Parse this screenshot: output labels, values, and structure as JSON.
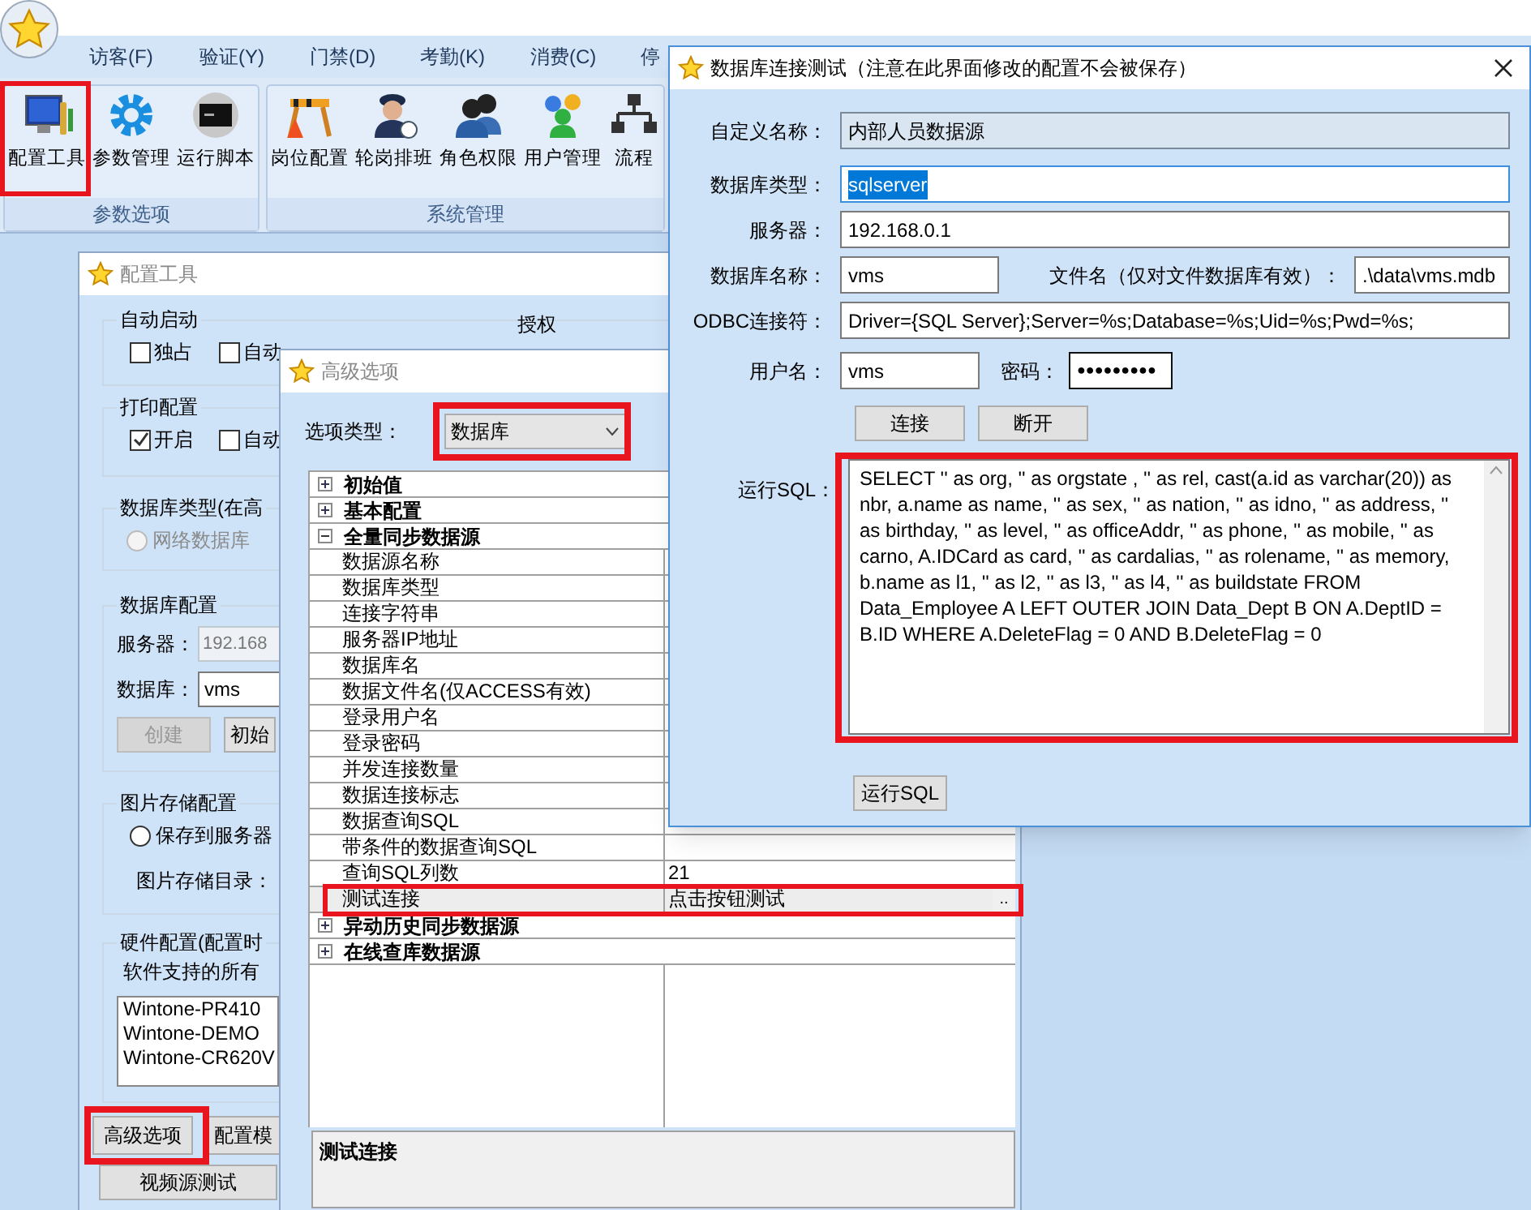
{
  "app": {
    "menu": [
      "访客(F)",
      "验证(Y)",
      "门禁(D)",
      "考勤(K)",
      "消费(C)",
      "停"
    ],
    "ribbon_groups": [
      {
        "label": "参数选项",
        "buttons": [
          {
            "label": "配置工具",
            "kind": "monitor"
          },
          {
            "label": "参数管理",
            "kind": "gear"
          },
          {
            "label": "运行脚本",
            "kind": "terminal"
          }
        ]
      },
      {
        "label": "系统管理",
        "buttons": [
          {
            "label": "岗位配置",
            "kind": "barrier"
          },
          {
            "label": "轮岗排班",
            "kind": "guard"
          },
          {
            "label": "角色权限",
            "kind": "pair"
          },
          {
            "label": "用户管理",
            "kind": "users"
          },
          {
            "label": "流程",
            "kind": "flow"
          }
        ]
      }
    ]
  },
  "config_tool": {
    "title": "配置工具",
    "auth_label": "授权",
    "auto_start": {
      "legend": "自动启动",
      "options": [
        {
          "label": "独占",
          "checked": false
        },
        {
          "label": "自动",
          "checked": false
        }
      ]
    },
    "print": {
      "legend": "打印配置",
      "options": [
        {
          "label": "开启",
          "checked": true
        },
        {
          "label": "自动",
          "checked": false
        }
      ]
    },
    "db_type": {
      "legend": "数据库类型(在高",
      "option": {
        "label": "网络数据库",
        "selected": false,
        "disabled": true
      }
    },
    "db_config": {
      "legend": "数据库配置",
      "server_label": "服务器：",
      "server_value": "192.168",
      "server_disabled": true,
      "database_label": "数据库：",
      "database_value": "vms",
      "buttons": [
        {
          "label": "创建",
          "disabled": true
        },
        {
          "label": "初始",
          "disabled": false
        }
      ]
    },
    "image_storage": {
      "legend": "图片存储配置",
      "option": {
        "label": "保存到服务器",
        "selected": false,
        "disabled": false
      },
      "dir_label": "图片存储目录："
    },
    "hardware": {
      "legend": "硬件配置(配置时",
      "caption": "软件支持的所有",
      "devices": [
        "Wintone-PR410",
        "Wintone-DEMO",
        "Wintone-CR620V"
      ]
    },
    "buttons": [
      "高级选项",
      "配置模"
    ],
    "video_button": "视频源测试"
  },
  "advanced_options": {
    "title": "高级选项",
    "option_type_label": "选项类型：",
    "option_type_value": "数据库",
    "grid": [
      {
        "label": "初始值",
        "expanded": false
      },
      {
        "label": "基本配置",
        "expanded": false
      },
      {
        "label": "全量同步数据源",
        "expanded": true,
        "children": [
          {
            "name": "数据源名称",
            "selected": false
          },
          {
            "name": "数据库类型",
            "selected": false
          },
          {
            "name": "连接字符串",
            "selected": false
          },
          {
            "name": "服务器IP地址",
            "selected": false
          },
          {
            "name": "数据库名",
            "selected": false
          },
          {
            "name": "数据文件名(仅ACCESS有效)",
            "selected": false
          },
          {
            "name": "登录用户名",
            "selected": false
          },
          {
            "name": "登录密码",
            "selected": false
          },
          {
            "name": "并发连接数量",
            "selected": false
          },
          {
            "name": "数据连接标志",
            "selected": false
          },
          {
            "name": "数据查询SQL",
            "selected": false
          },
          {
            "name": "带条件的数据查询SQL",
            "selected": false
          },
          {
            "name": "查询SQL列数",
            "value": "21",
            "selected": false
          },
          {
            "name": "测试连接",
            "value": "点击按钮测试",
            "button": "..",
            "selected": true
          }
        ]
      },
      {
        "label": "异动历史同步数据源",
        "expanded": false
      },
      {
        "label": "在线查库数据源",
        "expanded": false
      }
    ],
    "description": "测试连接"
  },
  "db_test": {
    "title": "数据库连接测试（注意在此界面修改的配置不会被保存）",
    "custom_name": {
      "label": "自定义名称：",
      "value": "内部人员数据源",
      "readonly": true
    },
    "db_type": {
      "label": "数据库类型：",
      "value": "sqlserver",
      "focused": true
    },
    "server": {
      "label": "服务器：",
      "value": "192.168.0.1"
    },
    "db_name": {
      "label": "数据库名称：",
      "value": "vms"
    },
    "file_name": {
      "label": "文件名（仅对文件数据库有效）：",
      "value": ".\\data\\vms.mdb"
    },
    "odbc": {
      "label": "ODBC连接符：",
      "value": "Driver={SQL Server};Server=%s;Database=%s;Uid=%s;Pwd=%s;"
    },
    "user": {
      "label": "用户名：",
      "value": "vms"
    },
    "password": {
      "label": "密码：",
      "value": "●●●●●●●●●"
    },
    "buttons": [
      "连接",
      "断开"
    ],
    "sql_label": "运行SQL：",
    "sql": "SELECT '' as org, '' as orgstate , '' as rel, cast(a.id as varchar(20)) as nbr, a.name as name, '' as sex, '' as nation, '' as idno, '' as address, '' as birthday, '' as level, '' as officeAddr, '' as phone, '' as mobile, '' as carno, A.IDCard as card, '' as cardalias, '' as rolename, '' as memory, b.name as l1, '' as l2, '' as l3, '' as l4, '' as buildstate FROM Data_Employee A LEFT OUTER JOIN Data_Dept B ON A.DeptID = B.ID WHERE A.DeleteFlag = 0 AND B.DeleteFlag = 0",
    "run_button": "运行SQL"
  }
}
